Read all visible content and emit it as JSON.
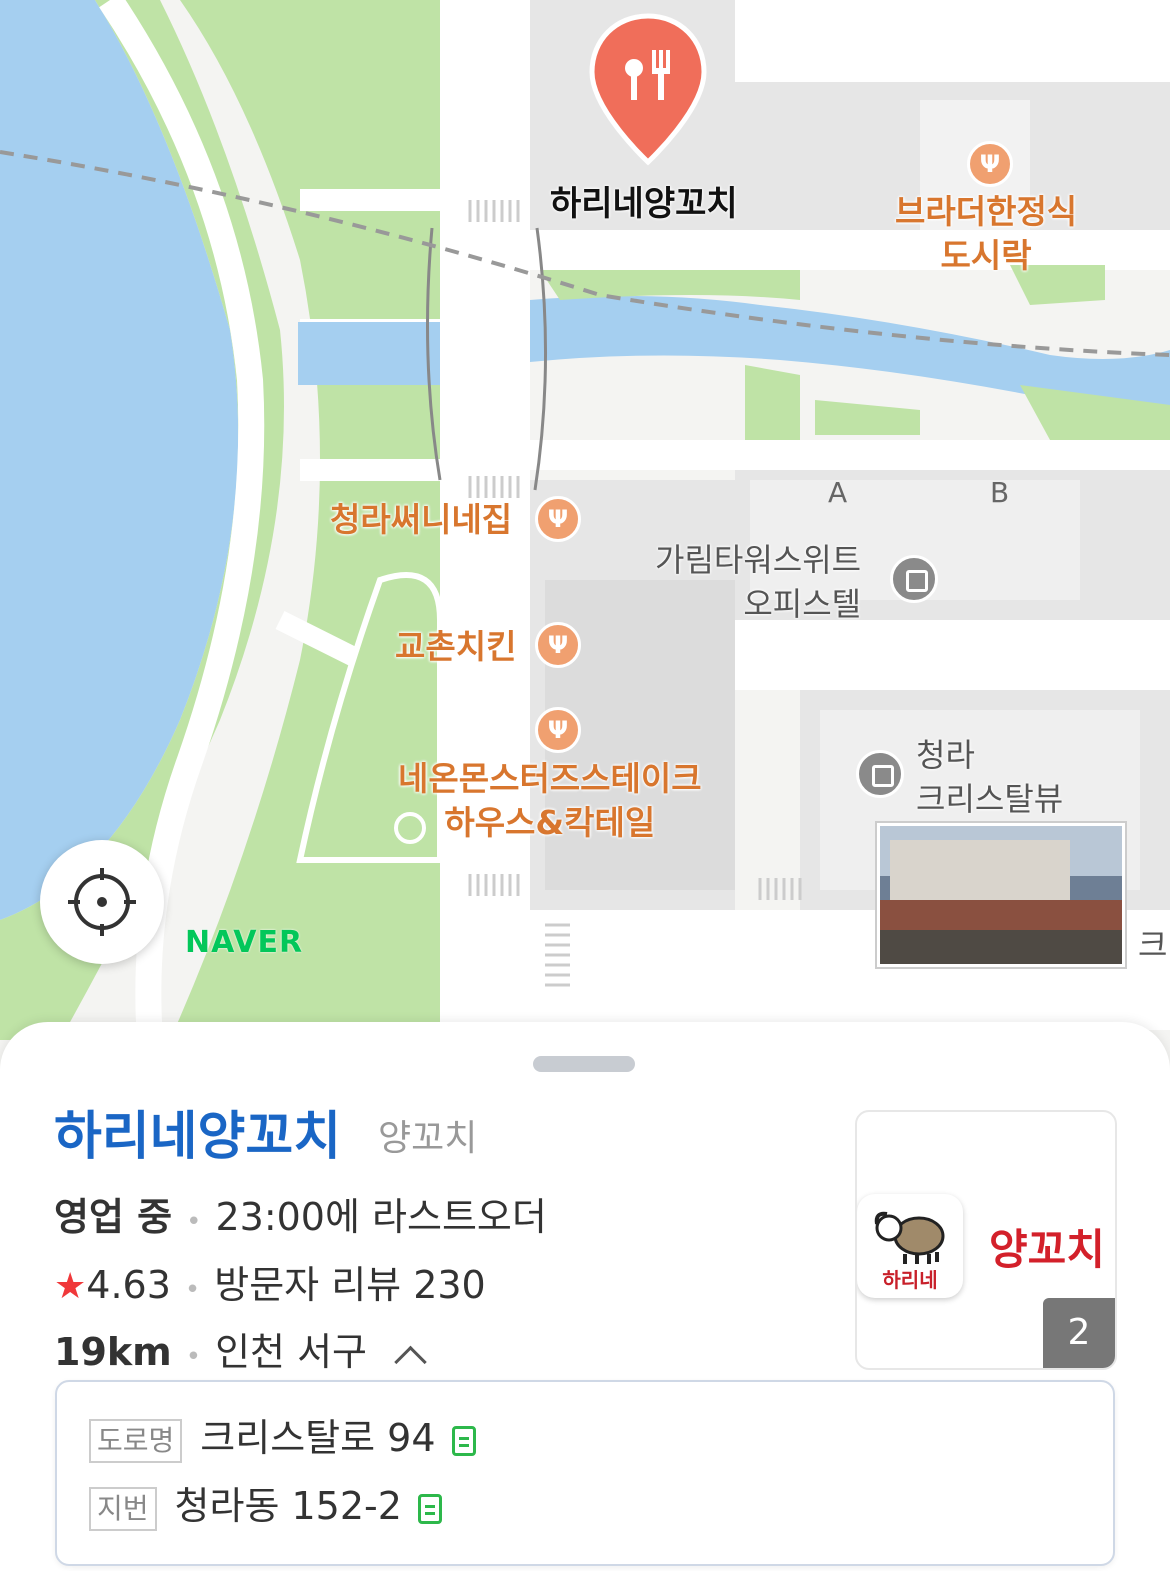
{
  "map": {
    "selected_place": "하리네양꼬치",
    "places": [
      {
        "label": "브라더한정식\n도시락",
        "icon": "restaurant-icon"
      },
      {
        "label": "청라써니네집",
        "icon": "restaurant-icon"
      },
      {
        "label": "교촌치킨",
        "icon": "restaurant-icon"
      },
      {
        "label": "네온몬스터즈스테이크\n하우스&칵테일",
        "icon": "restaurant-icon"
      }
    ],
    "buildings": [
      {
        "label": "가림타워스위트\n오피스텔",
        "icon": "building-icon"
      },
      {
        "label": "청라\n크리스탈뷰",
        "icon": "building-icon"
      }
    ],
    "block_labels": [
      "A",
      "B"
    ],
    "edge_label": "크",
    "brand": "NAVER",
    "colors": {
      "water": "#a5cff0",
      "park": "#bfe3a6",
      "road": "#ffffff",
      "block": "#e6e6e6",
      "pin": "#f06e5a",
      "brand": "#03c75a"
    }
  },
  "place": {
    "name": "하리네양꼬치",
    "category": "양꼬치",
    "status": "영업 중",
    "last_order": "23:00에 라스트오더",
    "rating": "4.63",
    "reviews": "방문자 리뷰 230",
    "distance": "19km",
    "region": "인천 서구",
    "photo_count": "2",
    "logo_text": "하리네",
    "banner_text": "양꼬치"
  },
  "address": {
    "road_tag": "도로명",
    "road": "크리스탈로 94",
    "lot_tag": "지번",
    "lot": "청라동 152-2"
  }
}
